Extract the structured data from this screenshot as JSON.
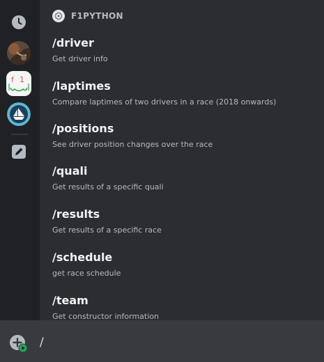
{
  "bot": {
    "name": "F1PYTHON"
  },
  "commands": [
    {
      "name": "/driver",
      "description": "Get driver info"
    },
    {
      "name": "/laptimes",
      "description": "Compare laptimes of two drivers in a race (2018 onwards)"
    },
    {
      "name": "/positions",
      "description": "See driver position changes over the race"
    },
    {
      "name": "/quali",
      "description": "Get results of a specific quali"
    },
    {
      "name": "/results",
      "description": "Get results of a specific race"
    },
    {
      "name": "/schedule",
      "description": "get race schedule"
    },
    {
      "name": "/team",
      "description": "Get constructor information"
    }
  ],
  "input": {
    "value": "/"
  },
  "rail": {
    "items": [
      {
        "icon": "clock-icon"
      },
      {
        "icon": "server-avatar"
      },
      {
        "icon": "f1-app-avatar"
      },
      {
        "icon": "boat-app-avatar"
      },
      {
        "icon": "edit-icon"
      }
    ]
  },
  "colors": {
    "background": "#313338",
    "panel": "#2b2d31",
    "rail": "#1f2124",
    "input": "#383a40",
    "text_primary": "#f2f3f5",
    "text_muted": "#b5bac1",
    "online_green": "#23a55a"
  }
}
